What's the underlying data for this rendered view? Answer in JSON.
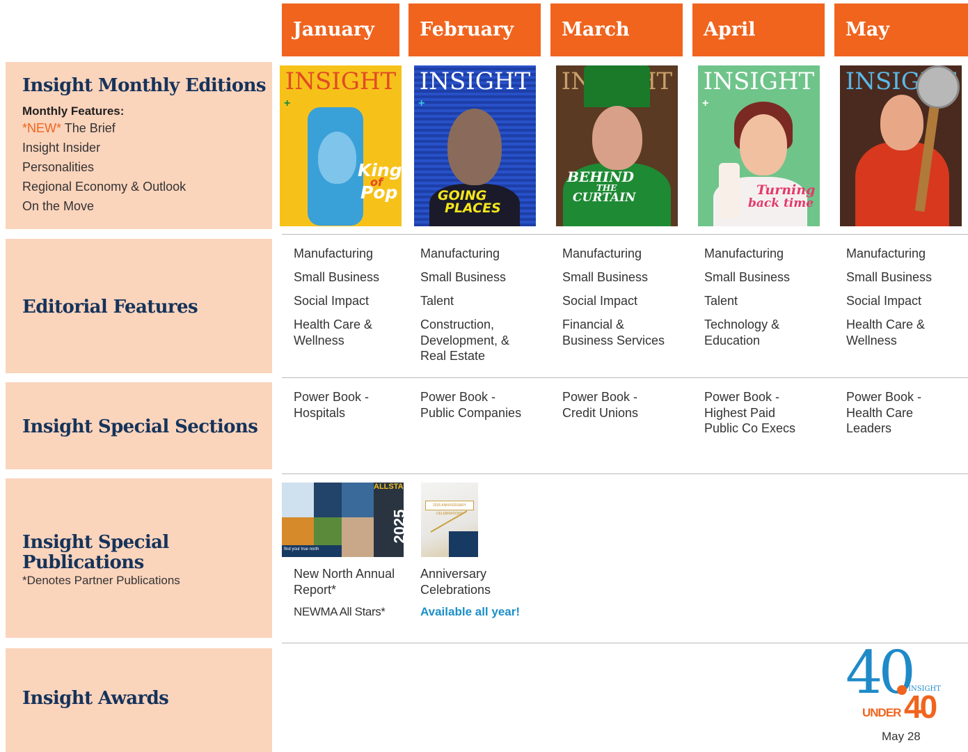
{
  "months": [
    "January",
    "February",
    "March",
    "April",
    "May"
  ],
  "rows": {
    "monthly": {
      "title": "Insight Monthly Editions",
      "features_label": "Monthly Features:",
      "new_tag": "*NEW*",
      "features": [
        "The Brief",
        "Insight Insider",
        "Personalities",
        "Regional Economy & Outlook",
        "On the Move"
      ]
    },
    "editorial": {
      "title": "Editorial Features"
    },
    "sections": {
      "title": "Insight Special Sections"
    },
    "publications": {
      "title_line1": "Insight Special",
      "title_line2": "Publications",
      "note": "*Denotes Partner Publications"
    },
    "awards": {
      "title": "Insight Awards"
    }
  },
  "covers": [
    {
      "masthead": "INSIGHT",
      "headline1": "King",
      "headline2": "of",
      "headline3": "Pop"
    },
    {
      "masthead": "INSIGHT",
      "headline1": "GOING",
      "headline2": "PLACES"
    },
    {
      "masthead": "INSIGHT",
      "headline1": "BEHIND",
      "headline2": "THE",
      "headline3": "CURTAIN"
    },
    {
      "masthead": "INSIGHT",
      "headline1": "Turning",
      "headline2": "back time"
    },
    {
      "masthead": "INSIGHT"
    }
  ],
  "editorial": [
    [
      "Manufacturing",
      "Small Business",
      "Social Impact",
      "Health Care & Wellness"
    ],
    [
      "Manufacturing",
      "Small Business",
      "Talent",
      "Construction, Development, & Real Estate"
    ],
    [
      "Manufacturing",
      "Small Business",
      "Social Impact",
      "Financial & Business Services"
    ],
    [
      "Manufacturing",
      "Small Business",
      "Talent",
      "Technology & Education"
    ],
    [
      "Manufacturing",
      "Small Business",
      "Social Impact",
      "Health Care & Wellness"
    ]
  ],
  "sections": [
    "Power Book - Hospitals",
    "Power Book - Public Companies",
    "Power Book - Credit Unions",
    "Power Book - Highest Paid Public Co Execs",
    "Power Book - Health Care Leaders"
  ],
  "publications": {
    "jan": {
      "title": "New North Annual Report*",
      "second": "NEWMA All Stars*",
      "thumb_text1": "ALLSTARS",
      "thumb_text2": "2025",
      "thumb_caption": "find your true north"
    },
    "feb": {
      "title": "Anniversary Celebrations",
      "availability": "Available all year!",
      "thumb_text": "2026 ANNIVERSARY CELEBRATIONS"
    }
  },
  "awards": {
    "logo_big": "40",
    "logo_under": "UNDER",
    "logo_small": "40",
    "logo_brand": "INSIGHT",
    "date": "May 28"
  },
  "colors": {
    "accent_orange": "#f0641e",
    "navy": "#15335a",
    "peach": "#fbd4bc",
    "link_blue": "#1b8fc8"
  }
}
